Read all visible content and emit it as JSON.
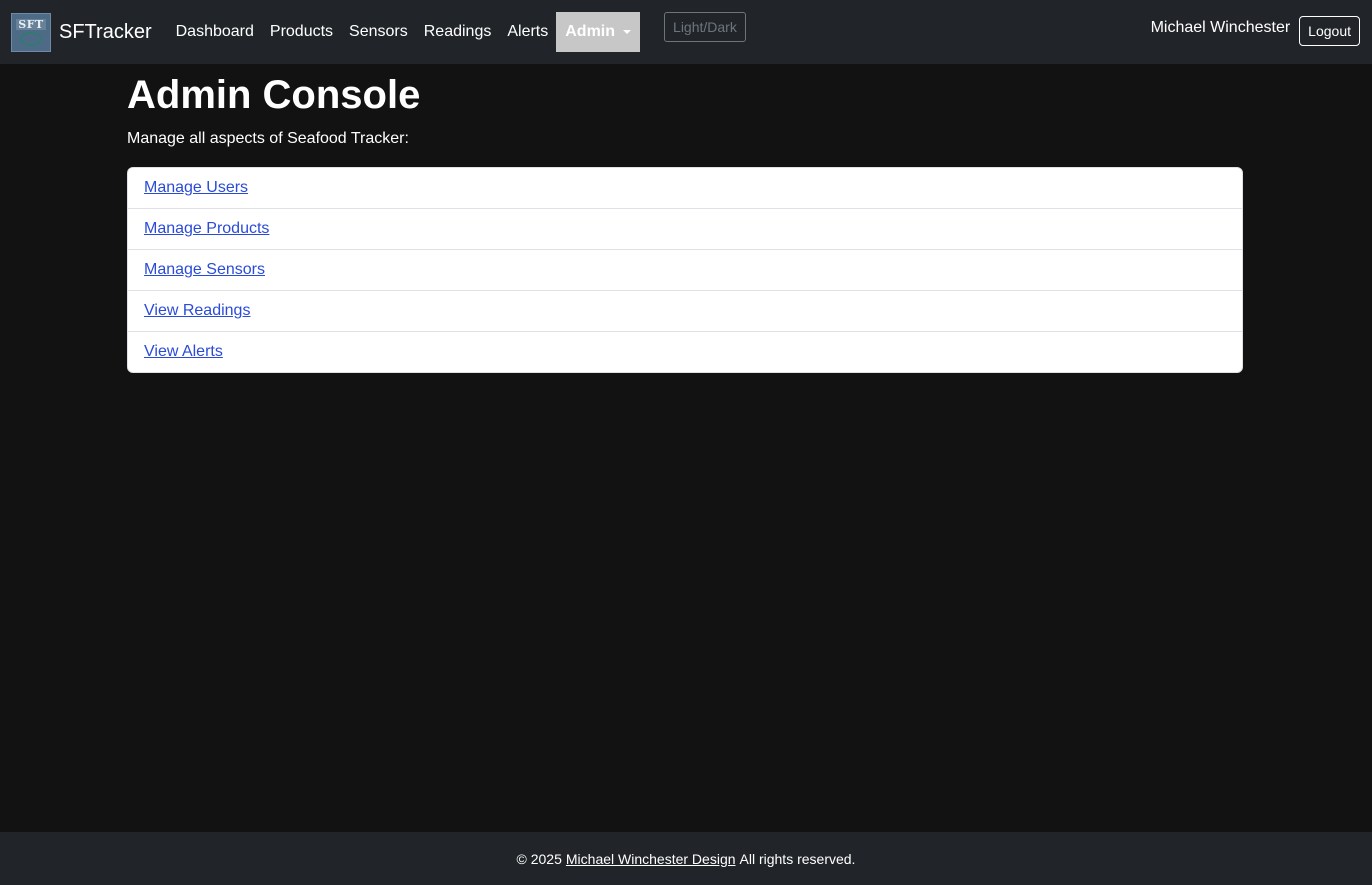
{
  "brand": {
    "logo_text": "SFT",
    "name": "SFTracker"
  },
  "nav": {
    "links": [
      "Dashboard",
      "Products",
      "Sensors",
      "Readings",
      "Alerts"
    ],
    "dropdown_label": "Admin",
    "toggle_label": "Light/Dark"
  },
  "user": {
    "name": "Michael Winchester",
    "logout_label": "Logout"
  },
  "main": {
    "title": "Admin Console",
    "subtitle": "Manage all aspects of Seafood Tracker:",
    "items": [
      "Manage Users",
      "Manage Products",
      "Manage Sensors",
      "View Readings",
      "View Alerts"
    ]
  },
  "footer": {
    "prefix": "© 2025",
    "link": "Michael Winchester Design",
    "suffix": "All rights reserved."
  },
  "colors": {
    "background": "#121212",
    "navbar": "#212529",
    "link": "#2a4bd7",
    "active_nav": "#c7c7c7"
  },
  "icons": {
    "dropdown": "caret-down-icon",
    "logo": "sft-logo-icon"
  }
}
